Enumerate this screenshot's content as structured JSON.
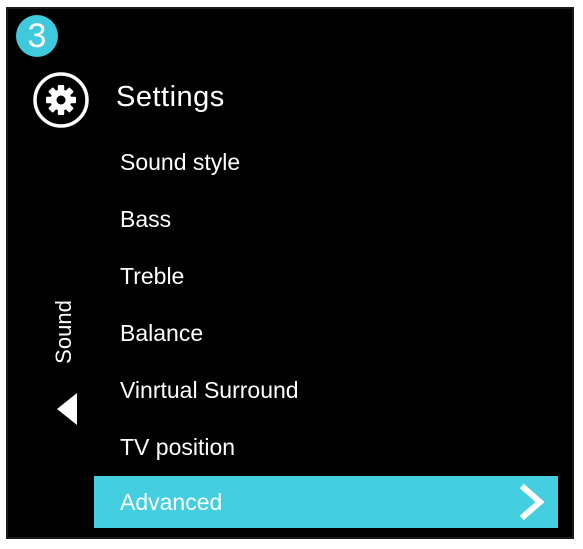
{
  "step_badge": "3",
  "header": {
    "title": "Settings",
    "icon": "gear-icon"
  },
  "side_panel": {
    "label": "Sound",
    "back_icon": "back-arrow-icon"
  },
  "menu": {
    "items": [
      {
        "label": "Sound style",
        "selected": false
      },
      {
        "label": "Bass",
        "selected": false
      },
      {
        "label": "Treble",
        "selected": false
      },
      {
        "label": "Balance",
        "selected": false
      },
      {
        "label": "Vinrtual Surround",
        "selected": false
      },
      {
        "label": "TV position",
        "selected": false
      },
      {
        "label": "Advanced",
        "selected": true
      }
    ],
    "selected_icon": "chevron-right-icon"
  },
  "colors": {
    "background": "#000000",
    "highlight": "#43cfe0",
    "badge": "#3fc9dc",
    "text": "#ffffff"
  }
}
